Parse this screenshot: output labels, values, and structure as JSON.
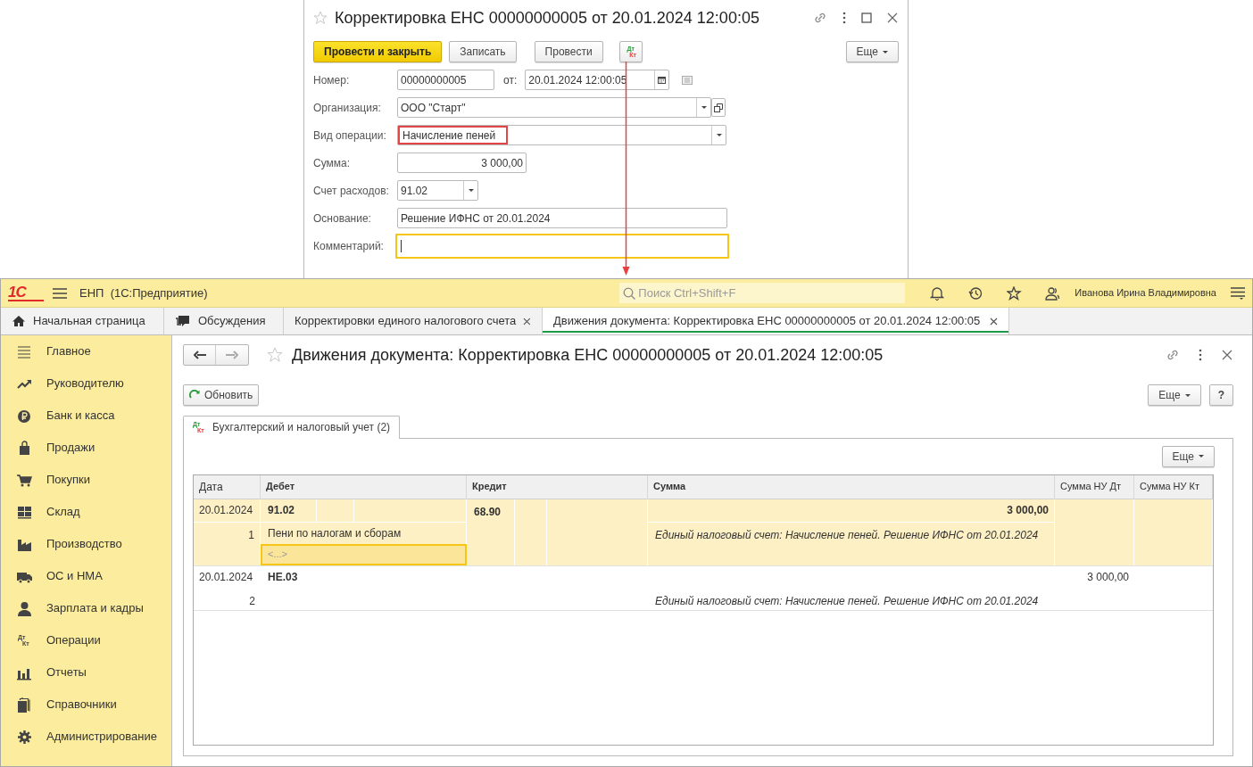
{
  "dialog": {
    "title": "Корректировка ЕНС 00000000005 от 20.01.2024 12:00:05",
    "buttons": [
      {
        "label": "Провести и закрыть",
        "kind": "primary"
      },
      {
        "label": "Записать",
        "kind": "default"
      },
      {
        "label": "Провести",
        "kind": "default"
      },
      {
        "kind": "dtkt",
        "top": "Дт",
        "bottom": "Кт"
      }
    ],
    "more": "Еще",
    "number": {
      "label": "Номер:",
      "value": "00000000005"
    },
    "date": {
      "label": "от:",
      "value": "20.01.2024 12:00:05"
    },
    "organization": {
      "label": "Организация:",
      "value": "ООО \"Старт\""
    },
    "operation": {
      "label": "Вид операции:",
      "value": "Начисление пеней",
      "highlighted": true
    },
    "amount": {
      "label": "Сумма:",
      "value": "3 000,00"
    },
    "expense_account": {
      "label": "Счет расходов:",
      "value": "91.02"
    },
    "basis": {
      "label": "Основание:",
      "value": "Решение ИФНС от 20.01.2024"
    },
    "comment": {
      "label": "Комментарий:",
      "focused": true
    }
  },
  "app": {
    "logo": "1С",
    "title": "ЕНП  (1С:Предприятие)",
    "search": {
      "placeholder": "Поиск Ctrl+Shift+F"
    },
    "user": "Иванова Ирина Владимировна"
  },
  "tabs": [
    {
      "label": "Начальная страница",
      "selected": false,
      "closable": false
    },
    {
      "label": "Обсуждения",
      "selected": false,
      "closable": false
    },
    {
      "label": "Корректировки единого налогового счета",
      "selected": false,
      "closable": true
    },
    {
      "label": "Движения документа: Корректировка ЕНС 00000000005 от 20.01.2024 12:00:05",
      "selected": true,
      "closable": true
    }
  ],
  "sidebar": {
    "items": [
      {
        "label": "Главное"
      },
      {
        "label": "Руководителю"
      },
      {
        "label": "Банк и касса"
      },
      {
        "label": "Продажи"
      },
      {
        "label": "Покупки"
      },
      {
        "label": "Склад"
      },
      {
        "label": "Производство"
      },
      {
        "label": "ОС и НМА"
      },
      {
        "label": "Зарплата и кадры"
      },
      {
        "label": "Операции",
        "icon_top": "Дт",
        "icon_bottom": "Кт"
      },
      {
        "label": "Отчеты"
      },
      {
        "label": "Справочники"
      },
      {
        "label": "Администрирование"
      }
    ]
  },
  "document": {
    "title": "Движения документа: Корректировка ЕНС 00000000005 от 20.01.2024 12:00:05",
    "refresh": "Обновить",
    "more": "Еще",
    "help": "?",
    "subtab": {
      "label": "Бухгалтерский и налоговый учет (2)",
      "selected": true,
      "icon_top": "Дт",
      "icon_bottom": "Кт"
    },
    "table_more": "Еще",
    "table": {
      "columns": [
        "Дата",
        "Дебет",
        "Кредит",
        "Сумма",
        "Сумма НУ Дт",
        "Сумма НУ Кт"
      ],
      "rows": [
        {
          "date": "20.01.2024",
          "number": "1",
          "debit": "91.02",
          "debit_subconto": [
            "Пени по налогам и сборам",
            "<...>"
          ],
          "credit": "68.90",
          "amount": "3 000,00",
          "description": "Единый налоговый счет: Начисление пеней. Решение ИФНС от 20.01.2024",
          "selected": true
        },
        {
          "date": "20.01.2024",
          "number": "2",
          "debit": "НЕ.03",
          "nu_dt": "3 000,00",
          "description": "Единый налоговый счет: Начисление пеней. Решение ИФНС от 20.01.2024",
          "selected": false
        }
      ]
    }
  }
}
